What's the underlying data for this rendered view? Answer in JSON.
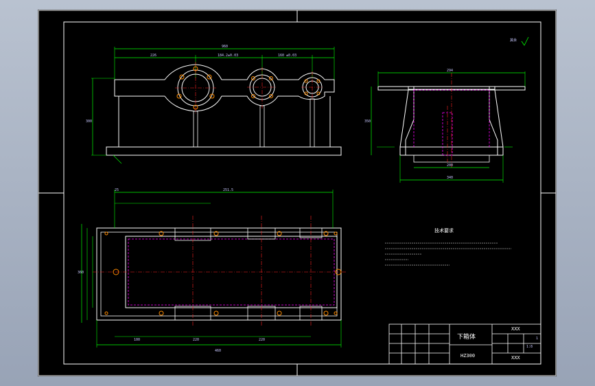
{
  "title_block": {
    "part_name": "下箱体",
    "code": "HZ300",
    "org_top": "XXX",
    "org_bottom": "XXX",
    "scale": "1:8",
    "sheet": "1"
  },
  "notes": {
    "heading": "技术要求"
  },
  "roughness": {
    "symbol": "其余"
  },
  "dimensions": {
    "top_overall": "960",
    "top_left": "226",
    "top_mid": "184.2±0.03",
    "top_right": "160 ±0.03",
    "front_height": "300",
    "side_top": "294",
    "side_height": "350",
    "side_inner": "200",
    "side_bottom": "340",
    "plan_left": "25",
    "plan_span": "251.5",
    "plan_overall": "460",
    "plan_width": "360",
    "plan_a": "100",
    "plan_b": "220",
    "plan_c": "220"
  },
  "colors": {
    "outline": "#ffffff",
    "dimension": "#00ff00",
    "center": "#ff2020",
    "hidden": "#ff00ff",
    "bolt": "#ff8c00",
    "frame": "#ffffff"
  }
}
